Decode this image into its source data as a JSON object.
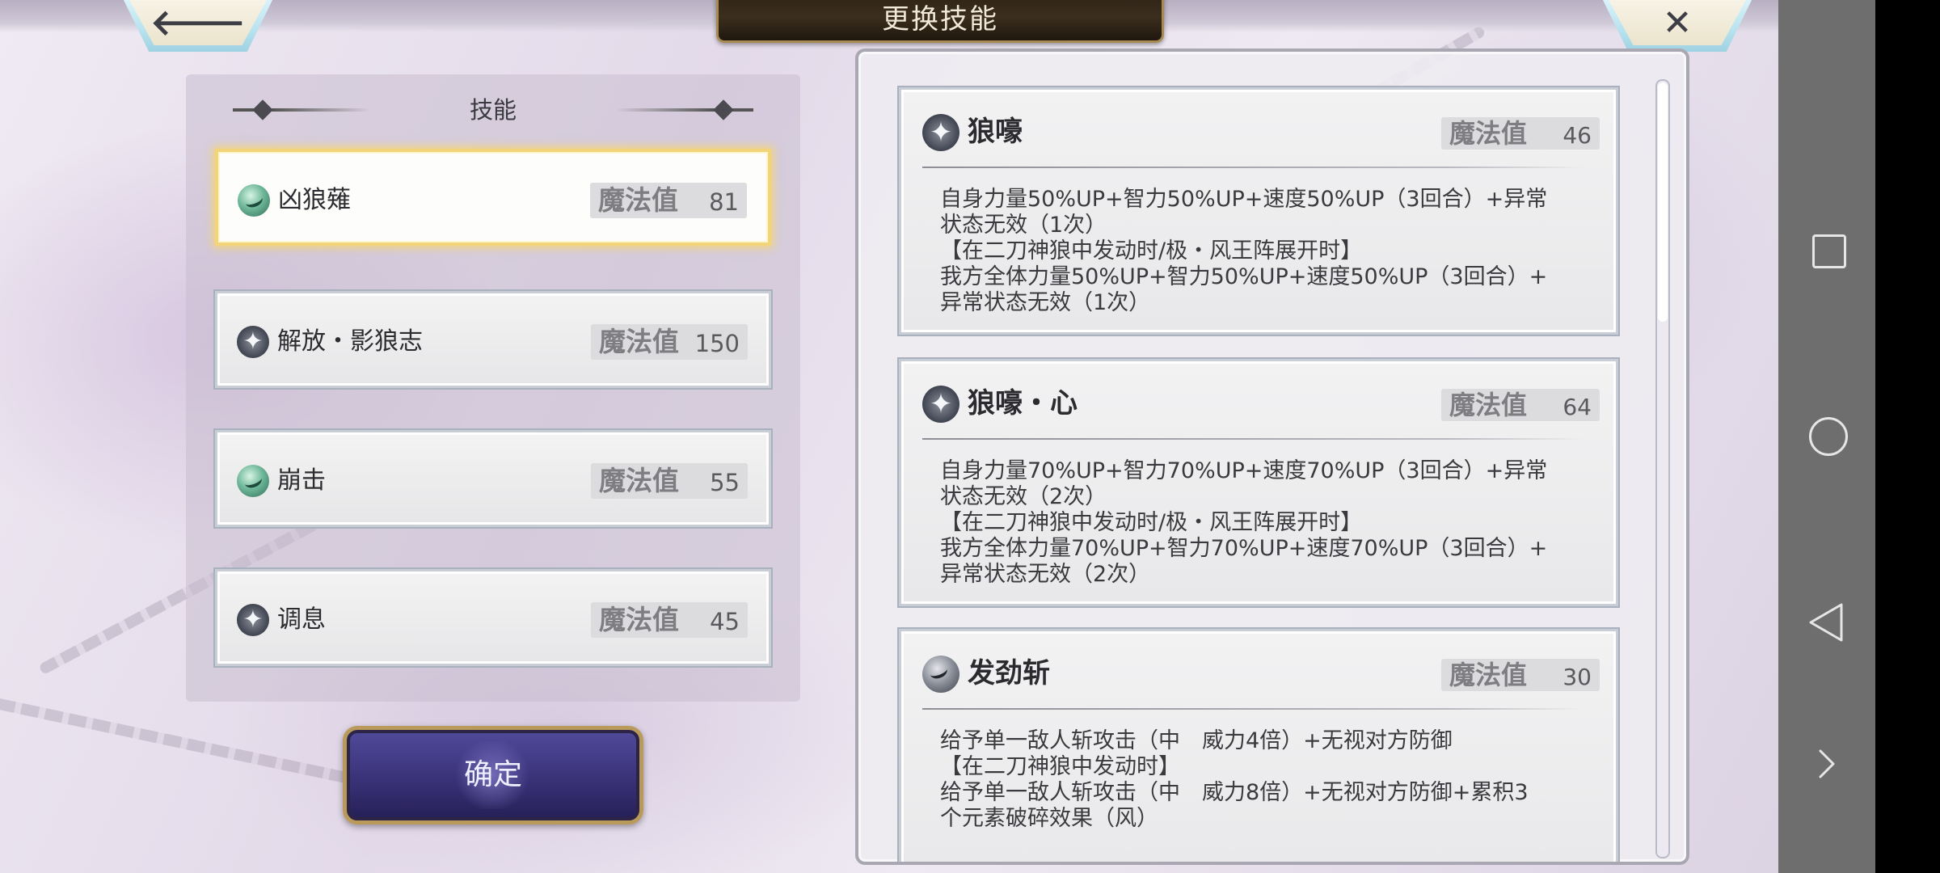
{
  "header": {
    "title": "更换技能",
    "back_glyph": "🡐",
    "close_glyph": "✕"
  },
  "left_panel": {
    "heading": "技能",
    "items": [
      {
        "icon": "green-slash-icon",
        "name": "凶狼薙",
        "mp_label": "魔法值",
        "mp_value": "81",
        "selected": true
      },
      {
        "icon": "star-burst-icon",
        "name": "解放・影狼志",
        "mp_label": "魔法值",
        "mp_value": "150",
        "selected": false
      },
      {
        "icon": "green-slash-icon",
        "name": "崩击",
        "mp_label": "魔法值",
        "mp_value": "55",
        "selected": false
      },
      {
        "icon": "star-burst-icon",
        "name": "调息",
        "mp_label": "魔法值",
        "mp_value": "45",
        "selected": false
      }
    ],
    "confirm_label": "确定"
  },
  "right_panel": {
    "cards": [
      {
        "icon": "star-burst-icon",
        "name": "狼嚎",
        "mp_label": "魔法值",
        "mp_value": "46",
        "description": "自身力量50%UP+智力50%UP+速度50%UP（3回合）+异常\n状态无效（1次）\n【在二刀神狼中发动时/极・风王阵展开时】\n我方全体力量50%UP+智力50%UP+速度50%UP（3回合）+\n异常状态无效（1次）"
      },
      {
        "icon": "star-burst-icon",
        "name": "狼嚎・心",
        "mp_label": "魔法值",
        "mp_value": "64",
        "description": "自身力量70%UP+智力70%UP+速度70%UP（3回合）+异常\n状态无效（2次）\n【在二刀神狼中发动时/极・风王阵展开时】\n我方全体力量70%UP+智力70%UP+速度70%UP（3回合）+\n异常状态无效（2次）"
      },
      {
        "icon": "gray-slash-icon",
        "name": "发劲斩",
        "mp_label": "魔法值",
        "mp_value": "30",
        "description": "给予单一敌人斩攻击（中　威力4倍）+无视对方防御\n【在二刀神狼中发动时】\n给予单一敌人斩攻击（中　威力8倍）+无视对方防御+累积3\n个元素破碎效果（风）"
      }
    ]
  },
  "colors": {
    "selected_glow": "#f2d47a",
    "title_bg": "#2d2317",
    "confirm_bg": "#3a3278",
    "nav_bar": "#6e6e6e"
  }
}
